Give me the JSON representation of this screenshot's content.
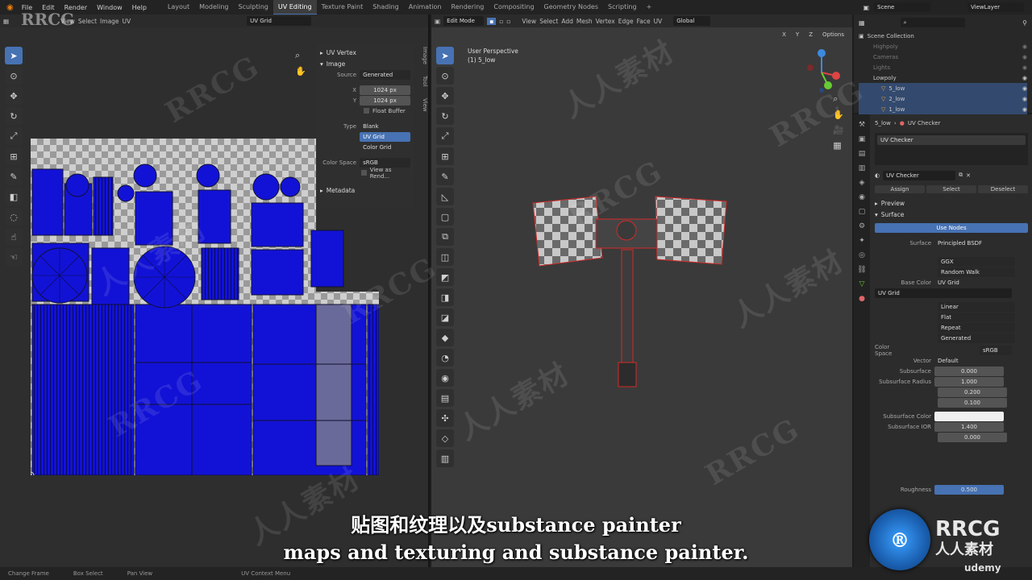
{
  "menu": [
    "File",
    "Edit",
    "Render",
    "Window",
    "Help"
  ],
  "workspaces": [
    "Layout",
    "Modeling",
    "Sculpting",
    "UV Editing",
    "Texture Paint",
    "Shading",
    "Animation",
    "Rendering",
    "Compositing",
    "Geometry Nodes",
    "Scripting"
  ],
  "active_workspace": "UV Editing",
  "scene": "Scene",
  "viewlayer": "ViewLayer",
  "uv_header": {
    "view": "View",
    "select": "Select",
    "image": "Image",
    "uv": "UV",
    "image_name": "UV Grid"
  },
  "uv_panel": {
    "section_uv_vertex": "UV Vertex",
    "section_image": "Image",
    "source_label": "Source",
    "source_value": "Generated",
    "x_label": "X",
    "x_value": "1024 px",
    "y_label": "Y",
    "y_value": "1024 px",
    "float_buffer": "Float Buffer",
    "type_label": "Type",
    "type_options": [
      "Blank",
      "UV Grid",
      "Color Grid"
    ],
    "type_selected": "UV Grid",
    "color_space_label": "Color Space",
    "color_space_value": "sRGB",
    "view_as_render": "View as Rend...",
    "metadata": "Metadata",
    "side_tabs": [
      "Image",
      "Tool",
      "View"
    ]
  },
  "viewport_header": {
    "mode": "Edit Mode",
    "view": "View",
    "select": "Select",
    "add": "Add",
    "mesh": "Mesh",
    "vertex": "Vertex",
    "edge": "Edge",
    "face": "Face",
    "uv": "UV",
    "orientation": "Global",
    "options": "Options",
    "axes": [
      "X",
      "Y",
      "Z"
    ]
  },
  "viewport_info": {
    "line1": "User Perspective",
    "line2": "(1) 5_low"
  },
  "outliner": {
    "root": "Scene Collection",
    "items": [
      "Highpoly",
      "Cameras",
      "Lights",
      "Lowpoly",
      "5_low",
      "2_low",
      "1_low"
    ]
  },
  "properties": {
    "breadcrumb_object": "5_low",
    "breadcrumb_material": "UV Checker",
    "material_slot": "UV Checker",
    "material_name": "UV Checker",
    "assign": "Assign",
    "select": "Select",
    "deselect": "Deselect",
    "preview": "Preview",
    "surface_section": "Surface",
    "use_nodes": "Use Nodes",
    "surface_label": "Surface",
    "surface_value": "Principled BSDF",
    "distribution": "GGX",
    "subsurface_method": "Random Walk",
    "base_color_label": "Base Color",
    "base_color_value": "UV Grid",
    "image_name": "UV Grid",
    "interpolation": "Linear",
    "projection": "Flat",
    "extension": "Repeat",
    "source": "Generated",
    "color_space_label": "Color Space",
    "color_space_value": "sRGB",
    "vector_label": "Vector",
    "vector_value": "Default",
    "subsurface_label": "Subsurface",
    "subsurface_value": "0.000",
    "subsurface_radius_label": "Subsurface Radius",
    "subsurface_radius": [
      "1.000",
      "0.200",
      "0.100"
    ],
    "subsurface_color_label": "Subsurface Color",
    "subsurface_ior_label": "Subsurface IOR",
    "subsurface_ior_value": "1.400",
    "extra_value": "0.000",
    "roughness_label": "Roughness",
    "roughness_value": "0.500"
  },
  "status": {
    "change_frame": "Change Frame",
    "box_select": "Box Select",
    "pan_view": "Pan View",
    "uv_context": "UV Context Menu"
  },
  "subtitle": {
    "zh": "贴图和纹理以及substance painter",
    "en": "maps and texturing and substance painter."
  },
  "logos": {
    "rrcg": "RRCG",
    "rrcg_cn": "人人素材",
    "udemy": "udemy",
    "watermark_en": "RRCG",
    "watermark_cn": "人人素材"
  },
  "colors": {
    "accent": "#4772b3",
    "uv_blue": "#1212d6",
    "selection_red": "#d42a2a"
  }
}
